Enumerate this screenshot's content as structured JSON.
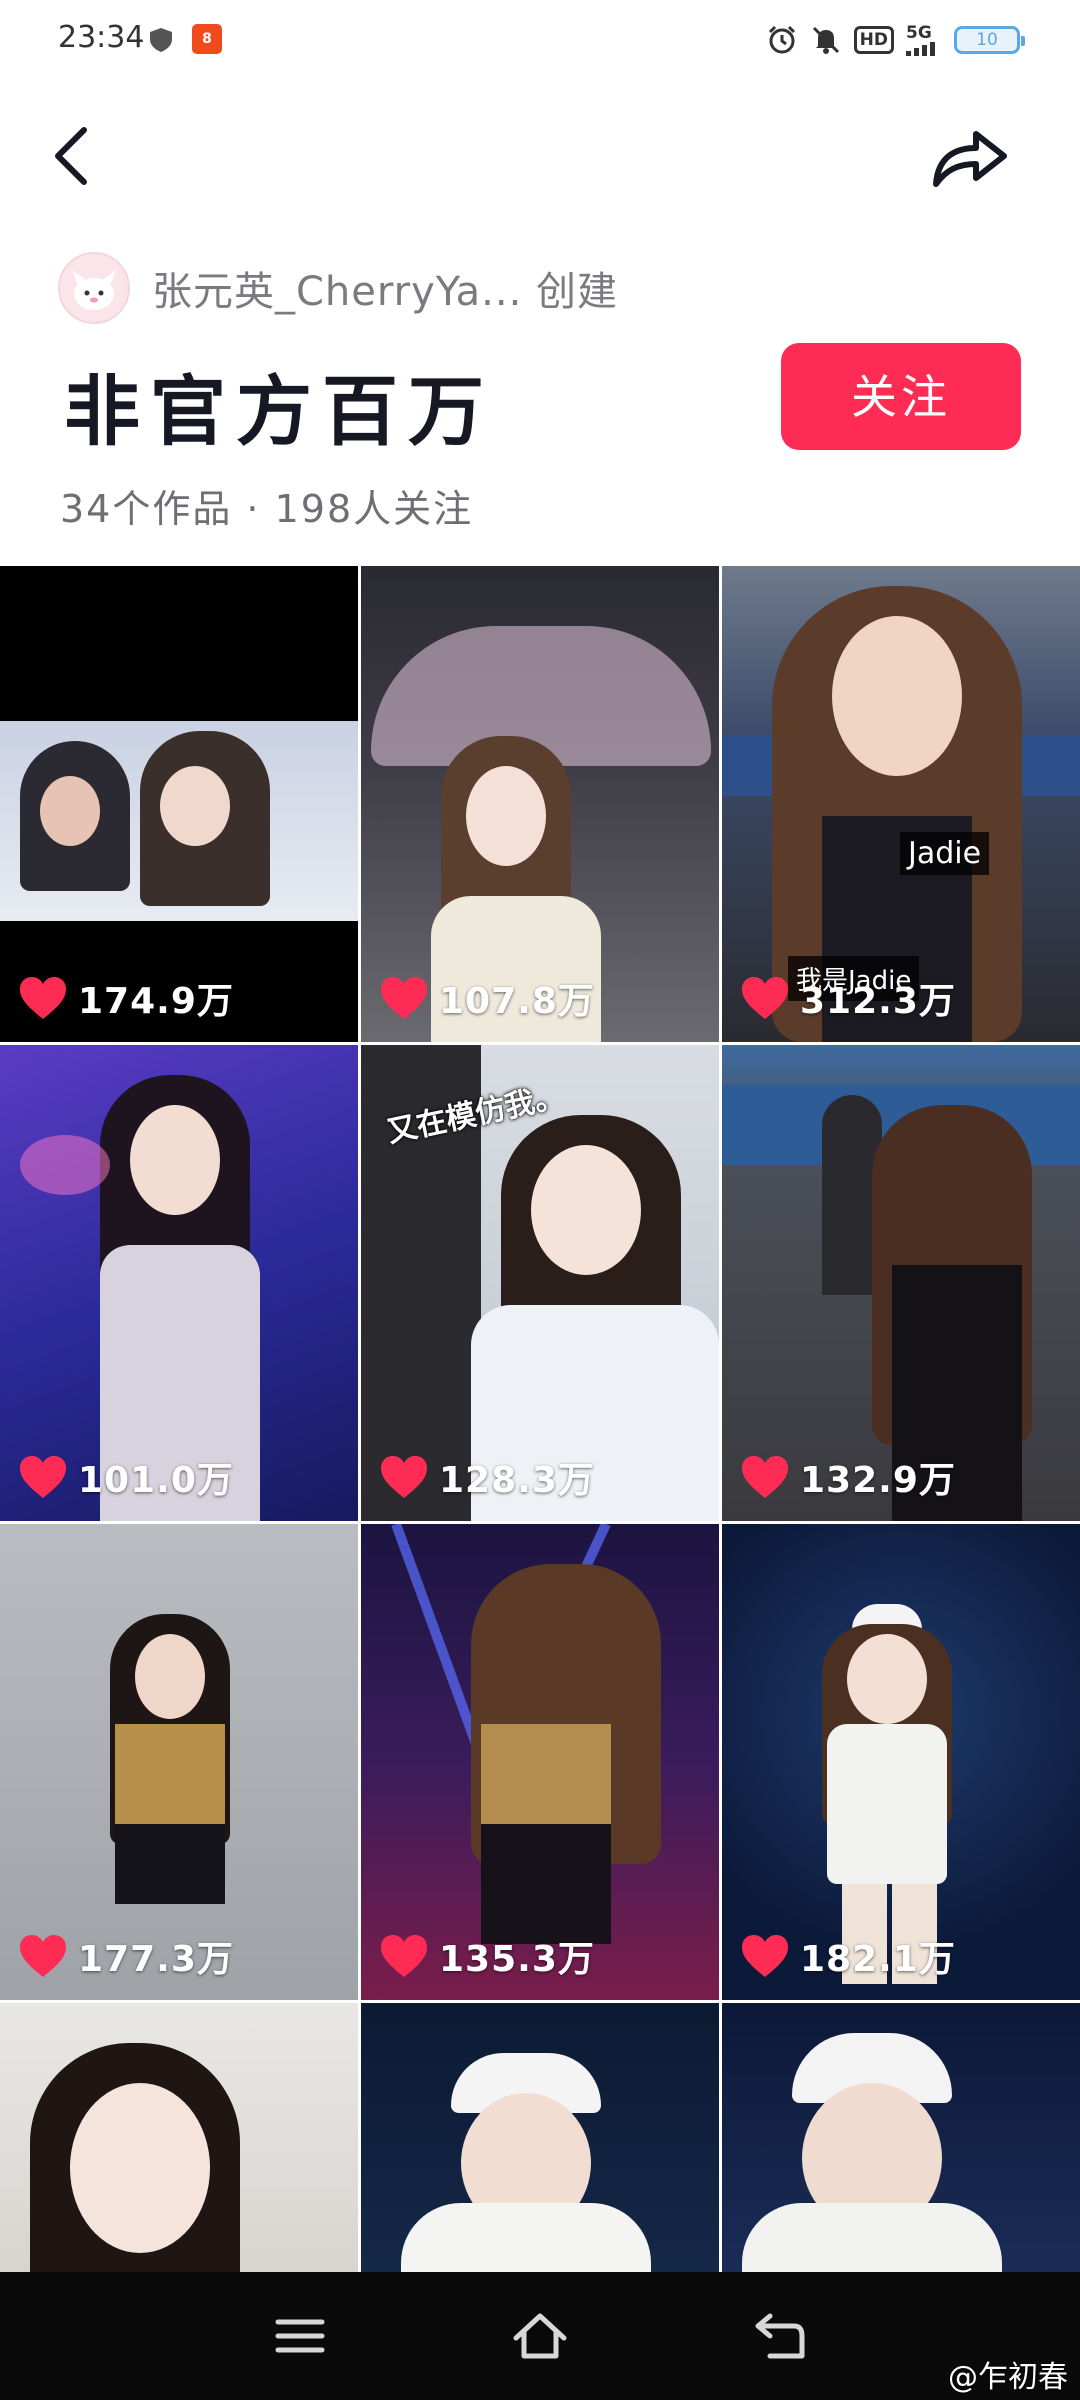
{
  "status_bar": {
    "time": "23:34",
    "app_badge": "8",
    "network": "5G",
    "hd": "HD",
    "battery": "10"
  },
  "collection": {
    "creator": "张元英_CherryYa... 创建",
    "title": "非官方百万",
    "follow_label": "关注",
    "stats": "34个作品 · 198人关注"
  },
  "videos": [
    {
      "likes": "174.9万"
    },
    {
      "likes": "107.8万"
    },
    {
      "likes": "312.3万",
      "caption_top": "Jadie",
      "caption_bottom": "我是Jadie"
    },
    {
      "likes": "101.0万"
    },
    {
      "likes": "128.3万",
      "caption_top": "又在模仿我。"
    },
    {
      "likes": "132.9万"
    },
    {
      "likes": "177.3万"
    },
    {
      "likes": "135.3万"
    },
    {
      "likes": "182.1万"
    },
    {
      "likes": ""
    },
    {
      "likes": ""
    },
    {
      "likes": ""
    }
  ],
  "watermark": "@乍初春",
  "colors": {
    "accent": "#fe2c55",
    "heart": "#fe2c55"
  },
  "icons": [
    "back-icon",
    "share-icon",
    "heart-icon",
    "menu-icon",
    "home-icon",
    "back-nav-icon"
  ]
}
